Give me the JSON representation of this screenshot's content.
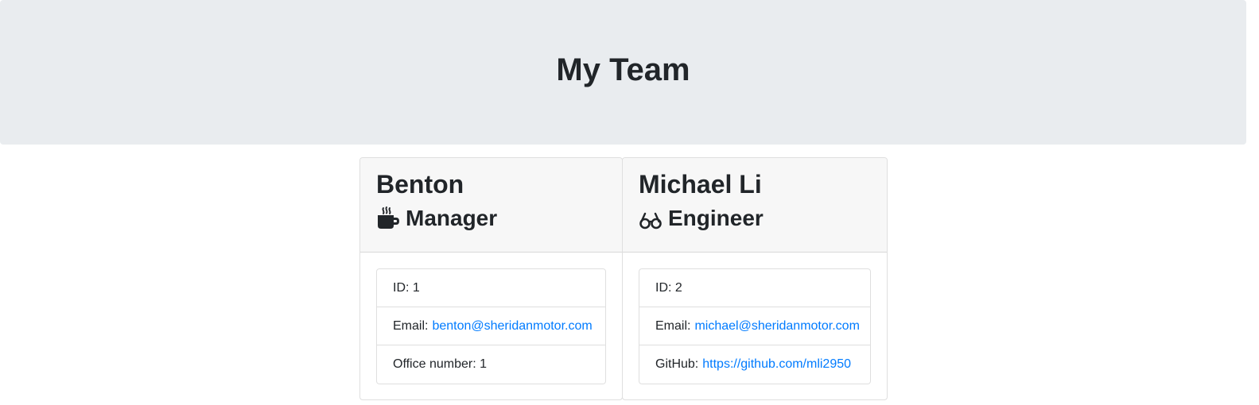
{
  "header": {
    "title": "My Team"
  },
  "cards": [
    {
      "name": "Benton",
      "role": "Manager",
      "role_icon": "mug-hot-icon",
      "items": [
        {
          "label": "ID:",
          "value": "1"
        },
        {
          "label": "Email:",
          "link": "benton@sheridanmotor.com"
        },
        {
          "label": "Office number:",
          "value": "1"
        }
      ]
    },
    {
      "name": "Michael Li",
      "role": "Engineer",
      "role_icon": "glasses-icon",
      "items": [
        {
          "label": "ID:",
          "value": "2"
        },
        {
          "label": "Email:",
          "link": "michael@sheridanmotor.com"
        },
        {
          "label": "GitHub:",
          "link": "https://github.com/mli2950"
        }
      ]
    }
  ],
  "colors": {
    "jumbotron_bg": "#e9ecef",
    "card_header_bg": "#f7f7f7",
    "link": "#007bff",
    "text": "#212529"
  }
}
